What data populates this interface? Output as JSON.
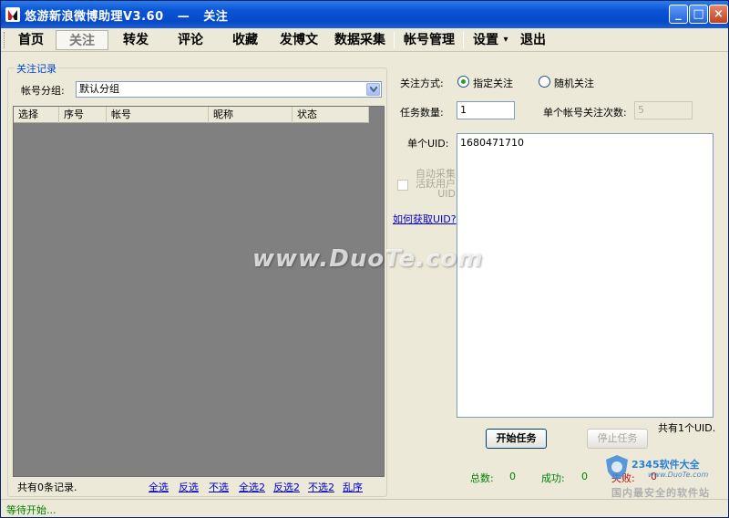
{
  "window": {
    "title": "悠游新浪微博助理V3.60   —   关注",
    "buttons": {
      "minimize": "_",
      "maximize": "□",
      "close": "×"
    }
  },
  "menu": {
    "items": [
      "首页",
      "关注",
      "转发",
      "评论",
      "收藏",
      "发博文",
      "数据采集",
      "帐号管理",
      "设置",
      "退出"
    ],
    "active": "关注",
    "dropdown_indicator": "▾"
  },
  "records": {
    "legend": "关注记录",
    "group_label": "帐号分组:",
    "group_value": "默认分组",
    "columns": [
      "选择",
      "序号",
      "帐号",
      "昵称",
      "状态"
    ],
    "rows": [],
    "count_text": "共有0条记录.",
    "links": [
      "全选",
      "反选",
      "不选",
      "全选2",
      "反选2",
      "不选2",
      "乱序"
    ]
  },
  "follow": {
    "mode_label": "关注方式:",
    "mode_options": [
      "指定关注",
      "随机关注"
    ],
    "mode_selected": "指定关注",
    "task_count_label": "任务数量:",
    "task_count_value": "1",
    "per_account_label": "单个帐号关注次数:",
    "per_account_value": "5",
    "uid_label": "单个UID:",
    "uid_value": "1680471710",
    "auto_collect_label": "自动采集活跃用户UID",
    "how_to_link": "如何获取UID?",
    "uid_count_text": "共有1个UID.",
    "start_button": "开始任务",
    "stop_button": "停止任务"
  },
  "stats": {
    "total_label": "总数:",
    "total_value": "0",
    "success_label": "成功:",
    "success_value": "0",
    "fail_label": "失败:",
    "fail_value": "0"
  },
  "status": {
    "text": "等待开始..."
  },
  "watermark": {
    "text": "www.DuoTe.com"
  },
  "badge": {
    "brand": "2345软件大全",
    "url": "www.DuoTe.com",
    "slogan": "国内最安全的软件站"
  }
}
